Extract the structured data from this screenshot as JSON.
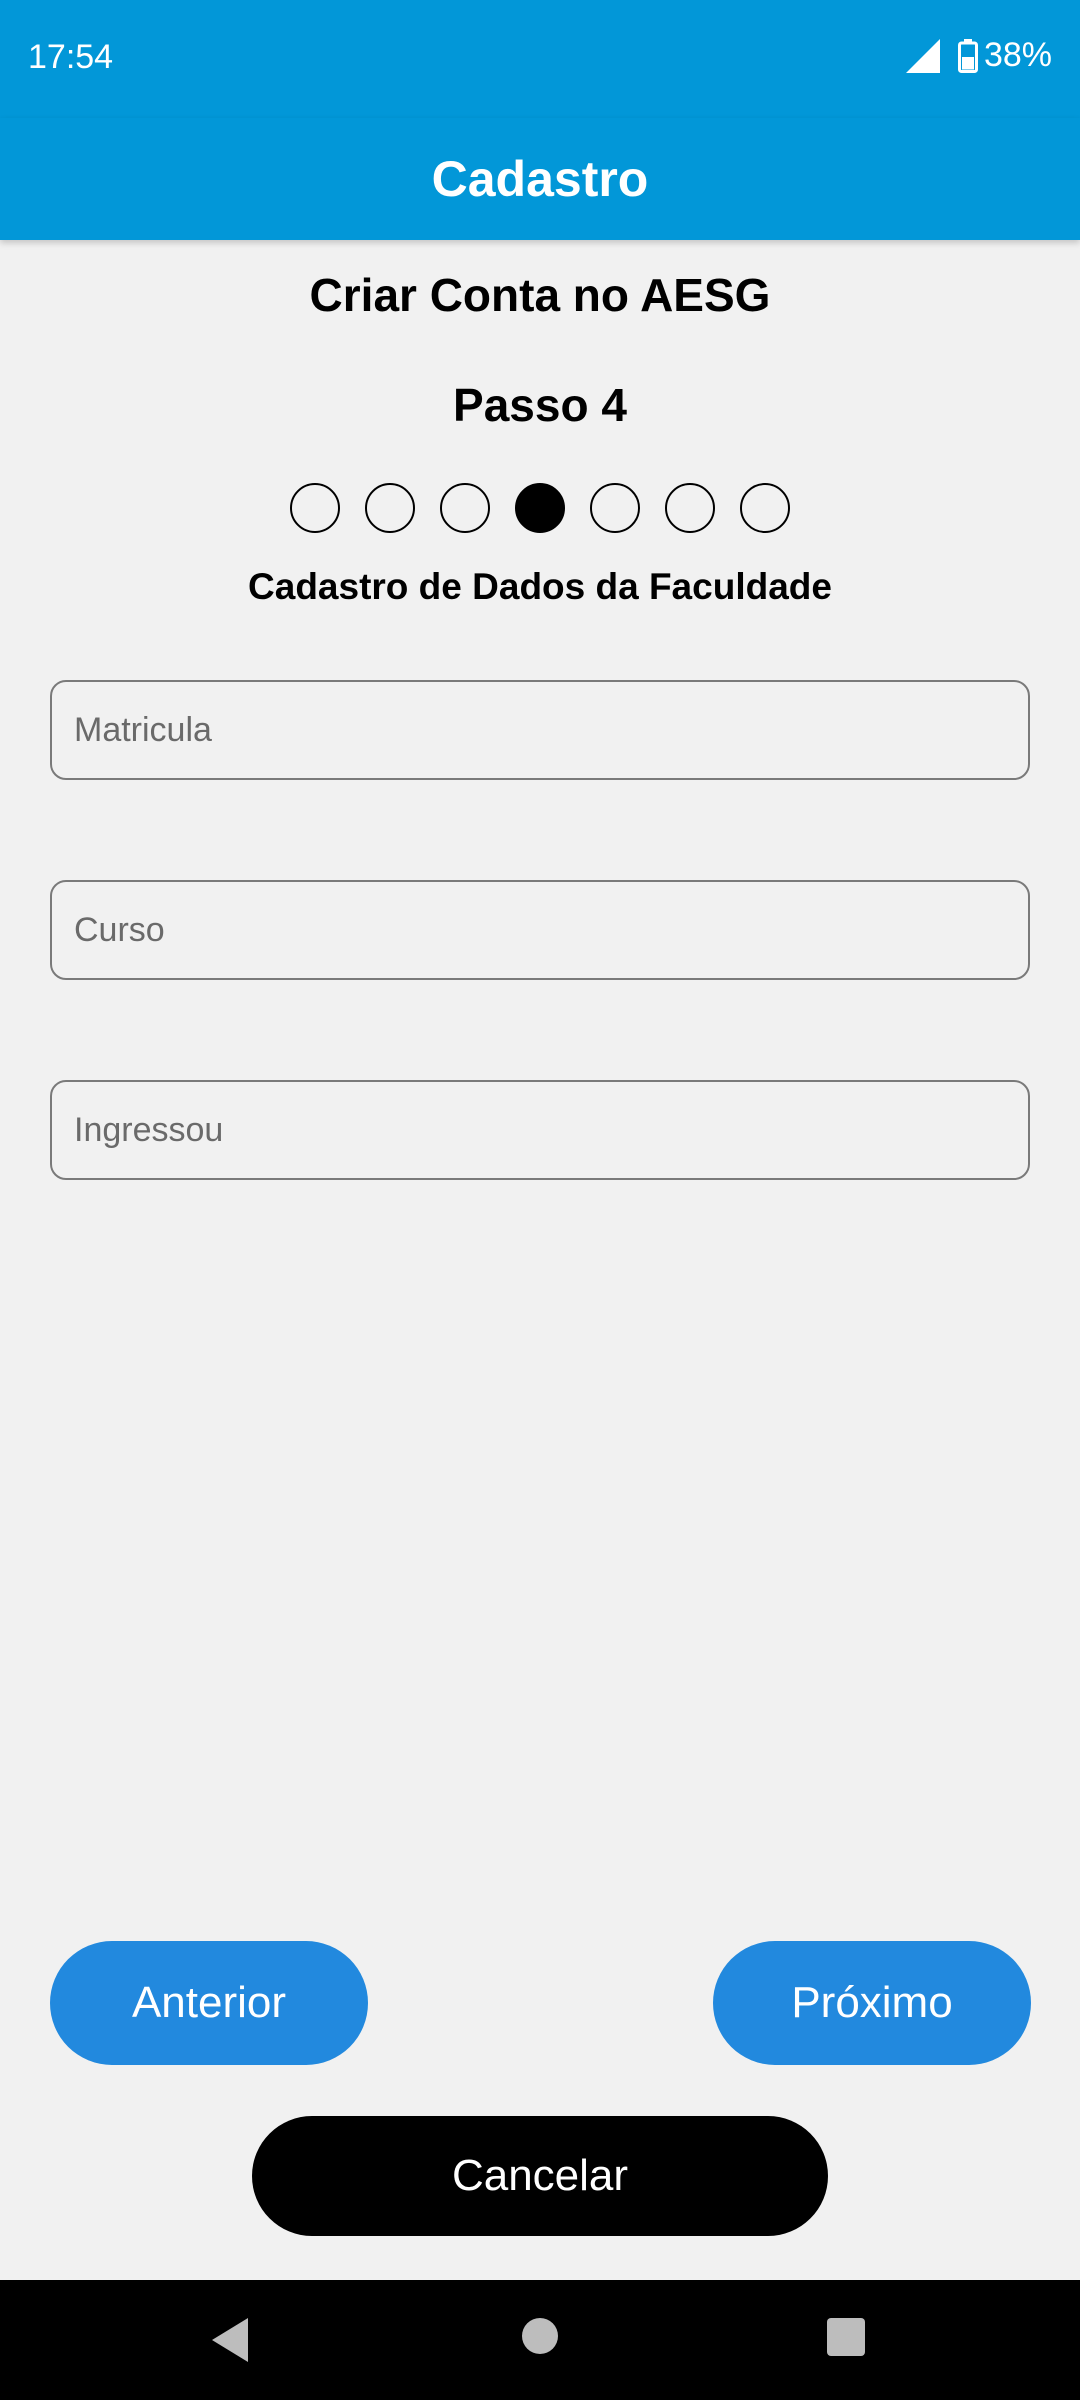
{
  "status_bar": {
    "time": "17:54",
    "battery": "38%",
    "icons": [
      "signal-icon",
      "battery-icon"
    ]
  },
  "app_bar": {
    "title": "Cadastro",
    "color": "#0297d8"
  },
  "form": {
    "heading": "Criar Conta no AESG",
    "step_label": "Passo 4",
    "steps": {
      "total": 7,
      "current": 4
    },
    "section_title": "Cadastro de Dados da Faculdade",
    "fields": {
      "registration": {
        "value": "",
        "placeholder": "Matricula"
      },
      "course": {
        "value": "",
        "placeholder": "Curso"
      },
      "enrolled": {
        "value": "",
        "placeholder": "Ingressou"
      }
    }
  },
  "buttons": {
    "previous": "Anterior",
    "next": "Próximo",
    "cancel": "Cancelar",
    "primary_color": "#2289de"
  },
  "nav_bar": {
    "icons": [
      "back-icon",
      "home-icon",
      "recent-apps-icon"
    ]
  }
}
